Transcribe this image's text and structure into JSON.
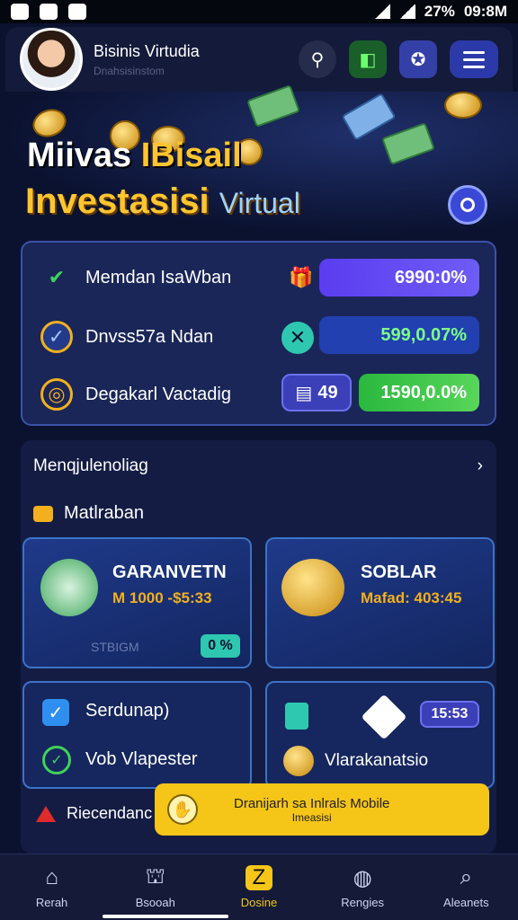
{
  "status_bar": {
    "battery": "27%",
    "time": "09:8M"
  },
  "header": {
    "title": "Bisinis Virtudia",
    "subtitle": "Dnahsisinstom"
  },
  "hero": {
    "title_part1": "Miivas ",
    "title_part2": "IBisail",
    "title_line2": "Investasisi ",
    "title_line2_suffix": "Virtual"
  },
  "stats": [
    {
      "label": "Memdan IsaWban",
      "value": "6990:0%"
    },
    {
      "label": "Dnvss57a  Ndan",
      "value": "599,0.07%"
    },
    {
      "label": "Degakarl Vactadig",
      "badge": "49",
      "value": "1590,0.0%"
    }
  ],
  "section": {
    "nav_label": "Menqjulenoliag",
    "category": "Matlraban"
  },
  "cards": [
    {
      "title": "GARANVETN",
      "subtitle": "M 1000 -$5:33",
      "footer": "STBIGM",
      "badge": "0 %"
    },
    {
      "title": "SOBLAR",
      "subtitle": "Mafad: 403:45"
    },
    {
      "items": [
        "Serdunap)",
        "Vob Vlapester"
      ]
    },
    {
      "badge": "15:53",
      "item": "Vlarakanatsio"
    }
  ],
  "warning": {
    "label": "Riecendanc"
  },
  "toast": {
    "line1": "Dranijarh sa Inlrals Mobile",
    "line2": "Imeasisi"
  },
  "bottom_nav": [
    {
      "label": "Rerah",
      "icon": "home-icon"
    },
    {
      "label": "Bsooah",
      "icon": "bank-icon"
    },
    {
      "label": "Dosine",
      "icon": "wallet-icon"
    },
    {
      "label": "Rengies",
      "icon": "globe-icon"
    },
    {
      "label": "Aleanets",
      "icon": "search-icon"
    }
  ],
  "colors": {
    "accent": "#f5c518",
    "positive": "#2ebd4a",
    "primary": "#3a48d6"
  }
}
